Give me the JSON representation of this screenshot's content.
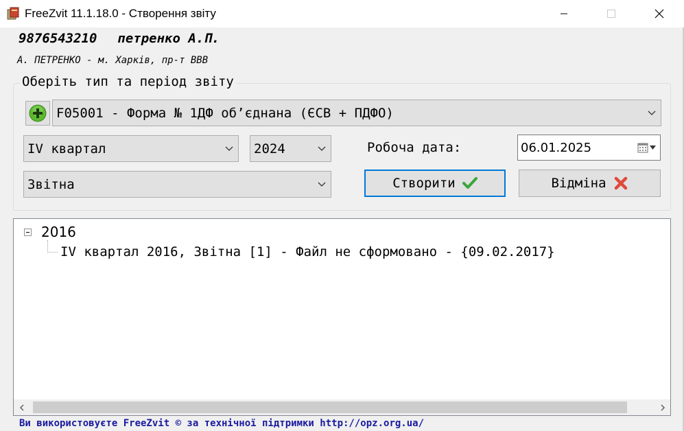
{
  "window": {
    "title": "FreeZvit 11.1.18.0 - Створення звіту"
  },
  "header": {
    "code": "9876543210",
    "name": "петренко А.П.",
    "address": "А. ПЕТРЕНКО - м. Харків, пр-т ВВВ"
  },
  "group": {
    "legend": "Оберіть тип та період звіту"
  },
  "form": {
    "selected": "F05001 - Форма № 1ДФ об’єднана (ЄСВ + ПДФО)"
  },
  "period": {
    "quarter": "IV квартал",
    "year": "2024",
    "type": "Звітна"
  },
  "work_date": {
    "label": "Робоча дата:",
    "value": "06.01.2025"
  },
  "buttons": {
    "create": "Створити",
    "cancel": "Відміна"
  },
  "tree": {
    "root": "2016",
    "child": "IV квартал 2016, Звітна [1] - Файл не сформовано - {09.02.2017}"
  },
  "status": {
    "text": "Ви використовуєте FreeZvit © за технічної підтримки http://opz.org.ua/"
  },
  "colors": {
    "accent": "#0078d7",
    "plus_green": "#5cb82e",
    "check_green": "#3aa53a",
    "cancel_red": "#e04a3a",
    "status_blue": "#1a1aa0"
  }
}
